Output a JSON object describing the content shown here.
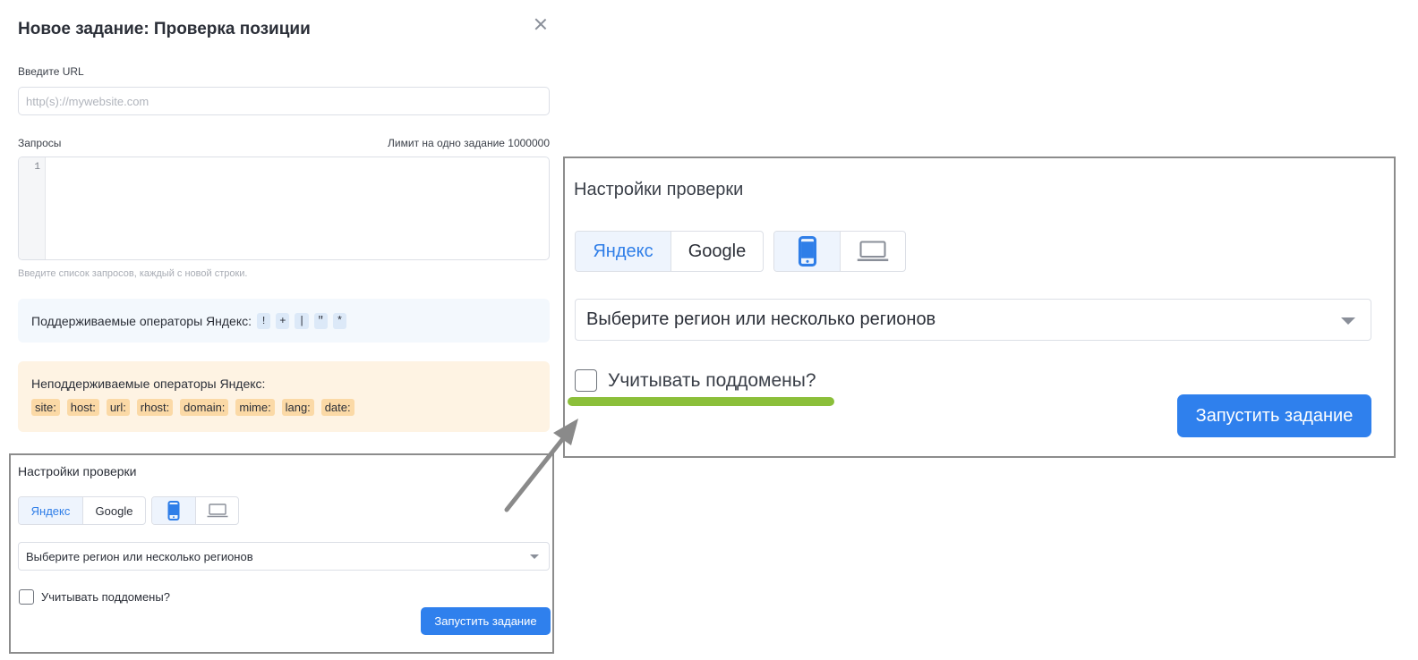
{
  "modal": {
    "title": "Новое задание: Проверка позиции",
    "close_icon": "close-icon"
  },
  "url": {
    "label": "Введите URL",
    "placeholder": "http(s)://mywebsite.com",
    "value": ""
  },
  "queries": {
    "label": "Запросы",
    "limit": "Лимит на одно задание 1000000",
    "line_number": "1",
    "hint": "Введите список запросов, каждый с новой строки."
  },
  "supported": {
    "label": "Поддерживаемые операторы Яндекс:",
    "operators": [
      "!",
      "+",
      "|",
      "\"",
      "*"
    ]
  },
  "unsupported": {
    "label": "Неподдерживаемые операторы Яндекс:",
    "operators": [
      "site:",
      "host:",
      "url:",
      "rhost:",
      "domain:",
      "mime:",
      "lang:",
      "date:"
    ]
  },
  "settings": {
    "title": "Настройки проверки",
    "engines": [
      {
        "label": "Яндекс",
        "active": true
      },
      {
        "label": "Google",
        "active": false
      }
    ],
    "devices": [
      {
        "icon": "mobile-icon",
        "active": true
      },
      {
        "icon": "laptop-icon",
        "active": false
      }
    ],
    "region_placeholder": "Выберите регион или несколько регионов",
    "subdomains_label": "Учитывать поддомены?",
    "subdomains_checked": false,
    "run_label": "Запустить задание"
  },
  "colors": {
    "accent": "#2f80ed",
    "info_bg": "#f3f8fd",
    "warn_bg": "#fef3e3",
    "warn_chip": "#fbd9a6",
    "highlight": "#8bbf3a",
    "callout_border": "#8c8c8c"
  }
}
